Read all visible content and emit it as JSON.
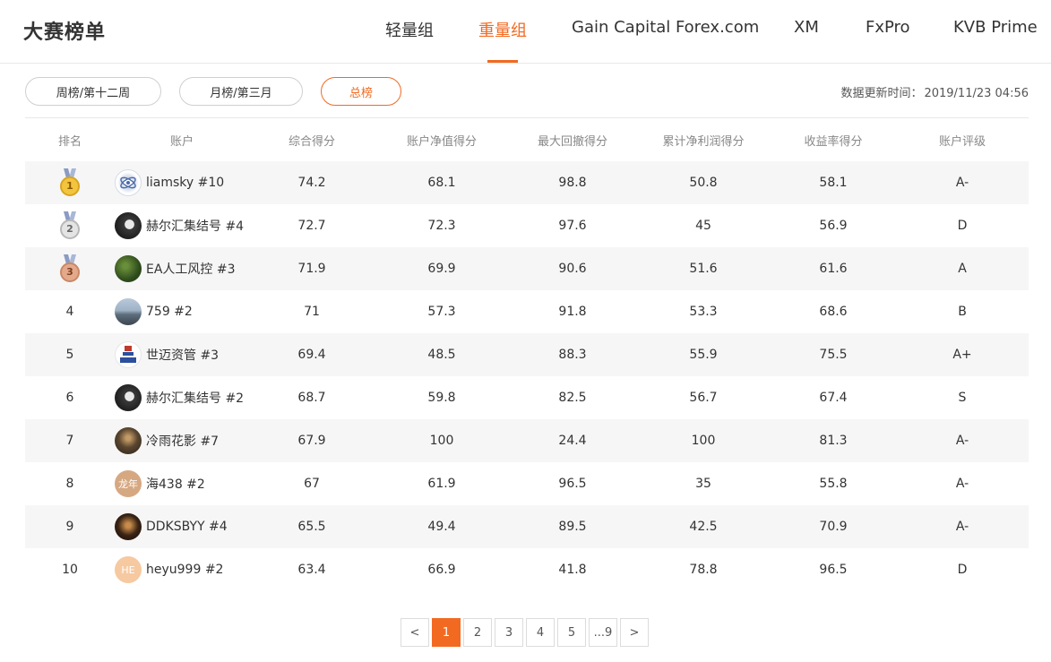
{
  "header": {
    "title": "大赛榜单",
    "tabs": [
      {
        "label": "轻量组",
        "active": false
      },
      {
        "label": "重量组",
        "active": true
      },
      {
        "label": "Gain Capital Forex.com",
        "active": false
      },
      {
        "label": "XM",
        "active": false
      },
      {
        "label": "FxPro",
        "active": false
      },
      {
        "label": "KVB Prime",
        "active": false
      }
    ],
    "accent_color": "#f26a21"
  },
  "filters": {
    "weekly": "周榜/第十二周",
    "monthly": "月榜/第三月",
    "overall": "总榜",
    "active": "总榜"
  },
  "update_time": {
    "label": "数据更新时间：",
    "value": "2019/11/23 04:56"
  },
  "table": {
    "columns": [
      "排名",
      "账户",
      "综合得分",
      "账户净值得分",
      "最大回撤得分",
      "累计净利润得分",
      "收益率得分",
      "账户评级"
    ],
    "rows": [
      {
        "rank": "1",
        "medal": "gold",
        "account": "liamsky #10",
        "avatar": "avatar-logo-icon",
        "total": "74.2",
        "equity": "68.1",
        "drawdown": "98.8",
        "profit": "50.8",
        "return": "58.1",
        "rating": "A-"
      },
      {
        "rank": "2",
        "medal": "silver",
        "account": "赫尔汇集结号 #4",
        "avatar": "avatar-portrait",
        "total": "72.7",
        "equity": "72.3",
        "drawdown": "97.6",
        "profit": "45",
        "return": "56.9",
        "rating": "D"
      },
      {
        "rank": "3",
        "medal": "bronze",
        "account": "EA人工风控 #3",
        "avatar": "avatar-forest",
        "total": "71.9",
        "equity": "69.9",
        "drawdown": "90.6",
        "profit": "51.6",
        "return": "61.6",
        "rating": "A"
      },
      {
        "rank": "4",
        "medal": "",
        "account": "759 #2",
        "avatar": "avatar-landscape",
        "total": "71",
        "equity": "57.3",
        "drawdown": "91.8",
        "profit": "53.3",
        "return": "68.6",
        "rating": "B"
      },
      {
        "rank": "5",
        "medal": "",
        "account": "世迈资管 #3",
        "avatar": "avatar-company-logo",
        "total": "69.4",
        "equity": "48.5",
        "drawdown": "88.3",
        "profit": "55.9",
        "return": "75.5",
        "rating": "A+"
      },
      {
        "rank": "6",
        "medal": "",
        "account": "赫尔汇集结号 #2",
        "avatar": "avatar-portrait",
        "total": "68.7",
        "equity": "59.8",
        "drawdown": "82.5",
        "profit": "56.7",
        "return": "67.4",
        "rating": "S"
      },
      {
        "rank": "7",
        "medal": "",
        "account": "冷雨花影 #7",
        "avatar": "avatar-night",
        "total": "67.9",
        "equity": "100",
        "drawdown": "24.4",
        "profit": "100",
        "return": "81.3",
        "rating": "A-"
      },
      {
        "rank": "8",
        "medal": "",
        "account": "海438 #2",
        "avatar": "avatar-text",
        "avatar_text": "龙年",
        "total": "67",
        "equity": "61.9",
        "drawdown": "96.5",
        "profit": "35",
        "return": "55.8",
        "rating": "A-"
      },
      {
        "rank": "9",
        "medal": "",
        "account": "DDKSBYY #4",
        "avatar": "avatar-dark",
        "total": "65.5",
        "equity": "49.4",
        "drawdown": "89.5",
        "profit": "42.5",
        "return": "70.9",
        "rating": "A-"
      },
      {
        "rank": "10",
        "medal": "",
        "account": "heyu999 #2",
        "avatar": "avatar-text",
        "avatar_text": "HE",
        "total": "63.4",
        "equity": "66.9",
        "drawdown": "41.8",
        "profit": "78.8",
        "return": "96.5",
        "rating": "D"
      }
    ]
  },
  "pagination": {
    "prev": "<",
    "pages": [
      "1",
      "2",
      "3",
      "4",
      "5",
      "...9"
    ],
    "current": "1",
    "next": ">"
  }
}
